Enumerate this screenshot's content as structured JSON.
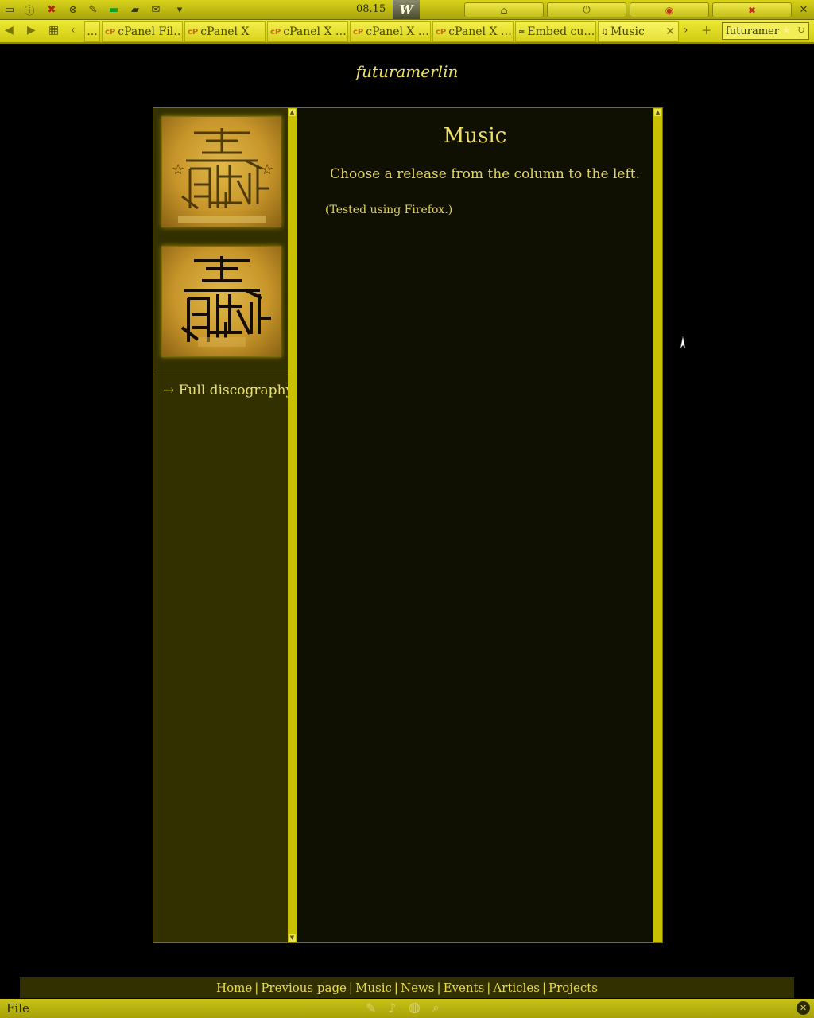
{
  "toolbar": {
    "clock": "08.15",
    "w_label": "W",
    "icons": [
      "minimize-icon",
      "info-icon",
      "tools-icon",
      "download-icon",
      "edit-icon",
      "battery-icon",
      "folder-icon",
      "mail-icon",
      "dropdown-icon",
      "home-icon",
      "power-icon",
      "chrome-icon",
      "close-x-icon"
    ]
  },
  "tabs": {
    "overflow_label": "...",
    "items": [
      {
        "label": "cPanel Fil…",
        "favicon": "cP"
      },
      {
        "label": "cPanel X",
        "favicon": "cP"
      },
      {
        "label": "cPanel X …",
        "favicon": "cP"
      },
      {
        "label": "cPanel X …",
        "favicon": "cP"
      },
      {
        "label": "cPanel X …",
        "favicon": "cP"
      },
      {
        "label": "Embed cu…",
        "favicon": "≈"
      },
      {
        "label": "Music",
        "favicon": "♫"
      }
    ],
    "url_text": "futuramer"
  },
  "site": {
    "title": "futuramerlin"
  },
  "sidebar": {
    "link_arrow": "→",
    "discography_label": "Full discography"
  },
  "main": {
    "heading": "Music",
    "intro": "Choose a release from the column to the left.",
    "note": "(Tested using Firefox.)"
  },
  "footer": {
    "links": [
      "Home",
      "Previous page",
      "Music",
      "News",
      "Events",
      "Articles",
      "Projects"
    ]
  },
  "status": {
    "file_label": "File"
  },
  "colors": {
    "accent": "#e6d84a",
    "toolbar": "#d8d21a",
    "sidebar_bg": "#333000",
    "content_bg": "#0f0f02"
  }
}
